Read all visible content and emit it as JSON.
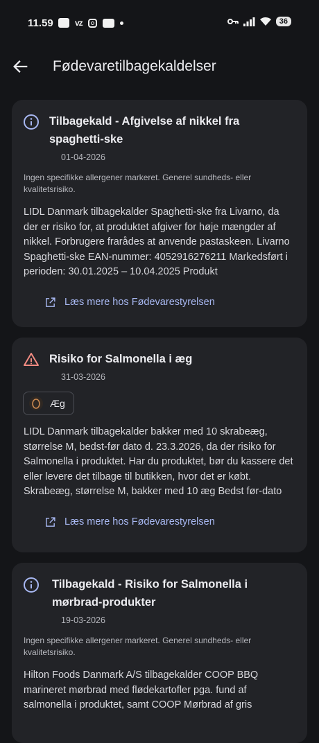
{
  "status_bar": {
    "time": "11.59",
    "carrier_icon": "vz",
    "battery": "36"
  },
  "app_bar": {
    "title": "Fødevaretilbagekaldelser"
  },
  "cards": [
    {
      "icon": "info-icon",
      "title": "Tilbagekald - Afgivelse af nikkel fra spaghetti-ske",
      "date": "01-04-2026",
      "risk_note": "Ingen specifikke allergener markeret. Generel sundheds- eller kvalitetsrisiko.",
      "body": "LIDL Danmark tilbagekalder Spaghetti-ske fra Livarno, da der er risiko for, at produktet afgiver for høje mængder af nikkel. Forbrugere frarådes at anvende pastaskeen. Livarno Spaghetti-ske EAN-nummer: 4052916276211 Markedsført i perioden: 30.01.2025 – 10.04.2025 Produkt",
      "link": "Læs mere hos Fødevarestyrelsen"
    },
    {
      "icon": "warning-icon",
      "title": "Risiko for Salmonella i æg",
      "date": "31-03-2026",
      "allergen_chip": "Æg",
      "body": "LIDL Danmark tilbagekalder bakker med 10 skrabeæg, størrelse M, bedst-før dato d. 23.3.2026, da der risiko for Salmonella i produktet. Har du produktet, bør du kassere det eller levere det tilbage til butikken, hvor det er købt. Skrabeæg, størrelse M, bakker med 10 æg Bedst før-dato",
      "link": "Læs mere hos Fødevarestyrelsen"
    },
    {
      "icon": "info-icon",
      "title": "Tilbagekald - Risiko for Salmonella i mørbrad-produkter",
      "date": "19-03-2026",
      "risk_note": "Ingen specifikke allergener markeret. Generel sundheds- eller kvalitetsrisiko.",
      "body": "Hilton Foods Danmark A/S tilbagekalder COOP BBQ marineret mørbrad med flødekartofler pga. fund af salmonella i produktet, samt COOP Mørbrad af gris"
    }
  ],
  "colors": {
    "background": "#141518",
    "card": "#222327",
    "link": "#a8b8f2",
    "warning": "#f28b82",
    "info": "#a8b8f2"
  }
}
